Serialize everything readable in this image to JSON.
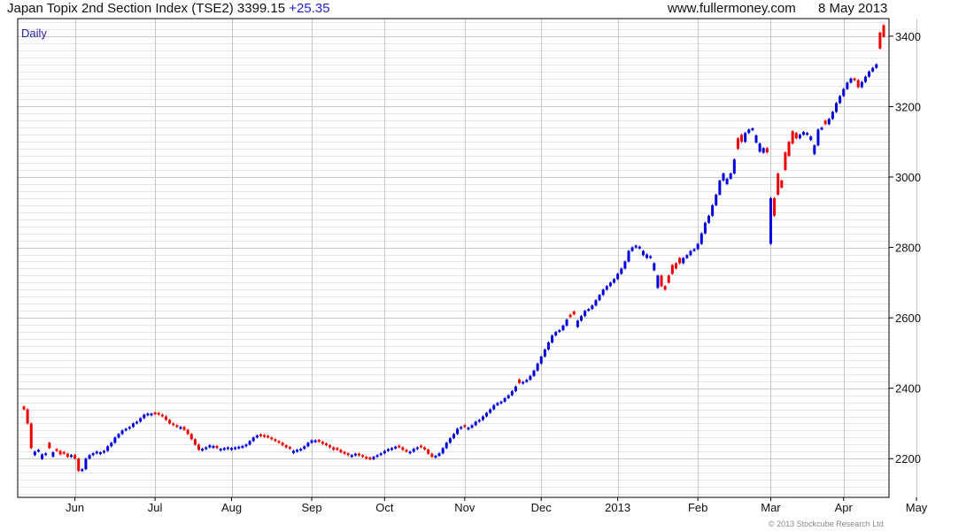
{
  "header": {
    "title": "Japan Topix 2nd Section Index (TSE2)",
    "last_value": "3399.15",
    "change": "+25.35",
    "site": "www.fullermoney.com",
    "date": "8 May 2013"
  },
  "footer": {
    "copyright": "© 2013 Stockcube Research Ltd"
  },
  "colors": {
    "up": "#0000dd",
    "down": "#ee0000",
    "grid_major": "#c8c8c8",
    "grid_minor": "#e6e6e6",
    "axis": "#000000"
  },
  "chart_data": {
    "type": "candlestick",
    "period_label": "Daily",
    "ylim": [
      2090,
      3450
    ],
    "y_ticks": [
      2200,
      2400,
      2600,
      2800,
      3000,
      3200,
      3400
    ],
    "y_axis_side": "right",
    "grid": true,
    "x_ticks": [
      {
        "label": "Jun",
        "index": 14
      },
      {
        "label": "Jul",
        "index": 36
      },
      {
        "label": "Aug",
        "index": 57
      },
      {
        "label": "Sep",
        "index": 79
      },
      {
        "label": "Oct",
        "index": 99
      },
      {
        "label": "Nov",
        "index": 121
      },
      {
        "label": "Dec",
        "index": 142
      },
      {
        "label": "2013",
        "index": 163
      },
      {
        "label": "Feb",
        "index": 185
      },
      {
        "label": "Mar",
        "index": 205
      },
      {
        "label": "Apr",
        "index": 225
      },
      {
        "label": "May",
        "index": 245
      }
    ],
    "closes": [
      2340,
      2300,
      2230,
      2220,
      2225,
      2212,
      2215,
      2230,
      2218,
      2222,
      2212,
      2214,
      2205,
      2210,
      2200,
      2165,
      2170,
      2200,
      2210,
      2215,
      2220,
      2218,
      2222,
      2235,
      2245,
      2260,
      2270,
      2280,
      2285,
      2290,
      2300,
      2305,
      2315,
      2325,
      2328,
      2328,
      2326,
      2325,
      2320,
      2310,
      2300,
      2295,
      2290,
      2290,
      2282,
      2270,
      2255,
      2240,
      2225,
      2228,
      2232,
      2238,
      2236,
      2230,
      2228,
      2230,
      2232,
      2230,
      2232,
      2234,
      2236,
      2240,
      2250,
      2260,
      2266,
      2264,
      2262,
      2260,
      2255,
      2250,
      2245,
      2238,
      2232,
      2228,
      2222,
      2225,
      2228,
      2235,
      2245,
      2252,
      2252,
      2248,
      2242,
      2238,
      2232,
      2225,
      2225,
      2218,
      2214,
      2210,
      2210,
      2214,
      2209,
      2205,
      2200,
      2198,
      2205,
      2210,
      2215,
      2222,
      2227,
      2230,
      2234,
      2232,
      2225,
      2220,
      2220,
      2228,
      2232,
      2232,
      2226,
      2214,
      2205,
      2208,
      2215,
      2230,
      2245,
      2258,
      2270,
      2285,
      2290,
      2290,
      2288,
      2295,
      2305,
      2310,
      2320,
      2330,
      2340,
      2352,
      2358,
      2362,
      2372,
      2380,
      2392,
      2405,
      2415,
      2418,
      2424,
      2435,
      2450,
      2470,
      2490,
      2510,
      2530,
      2550,
      2560,
      2565,
      2578,
      2595,
      2602,
      2610,
      2592,
      2605,
      2620,
      2625,
      2635,
      2650,
      2665,
      2680,
      2690,
      2700,
      2710,
      2725,
      2740,
      2760,
      2790,
      2800,
      2805,
      2802,
      2790,
      2780,
      2775,
      2755,
      2720,
      2690,
      2680,
      2700,
      2725,
      2740,
      2755,
      2770,
      2778,
      2790,
      2795,
      2810,
      2840,
      2870,
      2890,
      2920,
      2950,
      2990,
      3010,
      2995,
      3010,
      3050,
      3080,
      3100,
      3125,
      3135,
      3138,
      3118,
      3095,
      3082,
      3070,
      2940,
      2890,
      2950,
      2970,
      3020,
      3060,
      3095,
      3110,
      3120,
      3128,
      3125,
      3115,
      3090,
      3135,
      3140,
      3150,
      3165,
      3185,
      3210,
      3230,
      3250,
      3268,
      3280,
      3275,
      3255,
      3270,
      3285,
      3300,
      3310,
      3320,
      3365,
      3398
    ],
    "down_days": [
      0,
      1,
      2,
      7,
      9,
      10,
      11,
      12,
      14,
      15,
      36,
      37,
      38,
      39,
      40,
      41,
      42,
      44,
      45,
      46,
      47,
      48,
      53,
      65,
      66,
      67,
      68,
      69,
      70,
      71,
      72,
      73,
      81,
      82,
      83,
      84,
      85,
      86,
      87,
      88,
      89,
      92,
      93,
      94,
      95,
      103,
      104,
      105,
      109,
      110,
      111,
      112,
      121,
      136,
      150,
      151,
      175,
      176,
      177,
      178,
      179,
      180,
      196,
      197,
      204,
      206,
      207,
      208,
      209,
      210,
      211,
      212,
      220,
      228,
      229,
      235,
      236
    ]
  }
}
